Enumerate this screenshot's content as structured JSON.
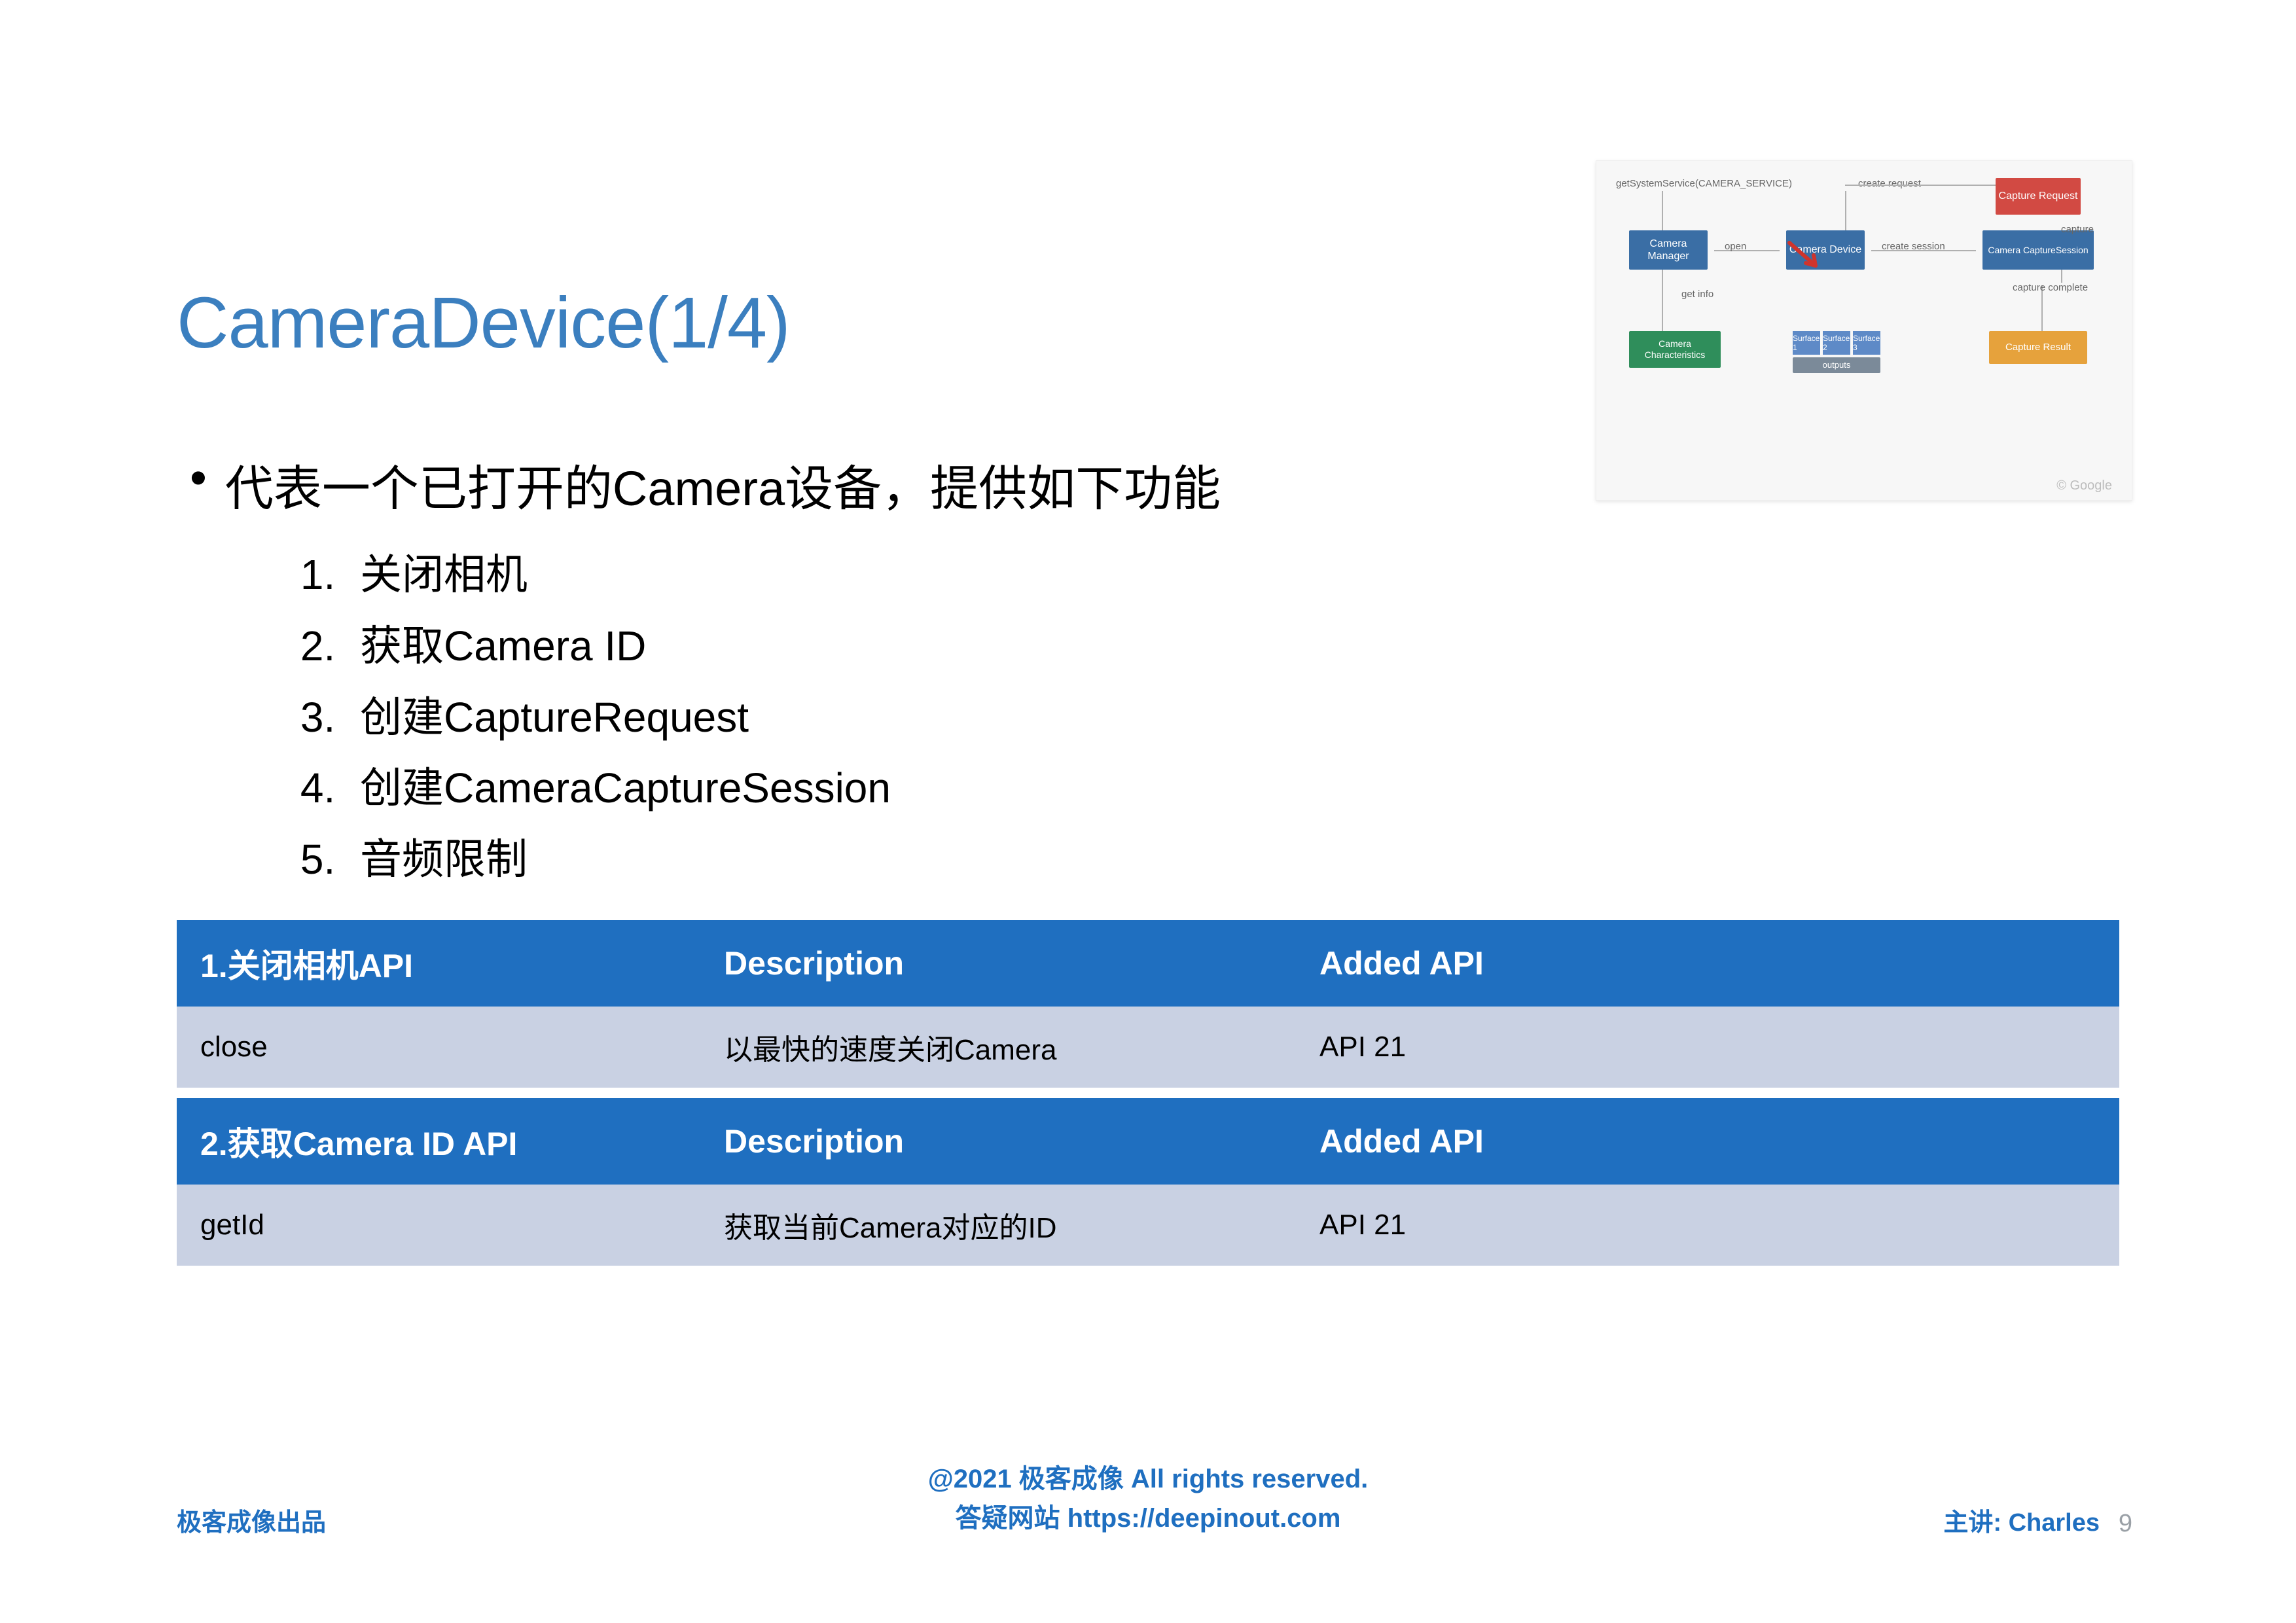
{
  "title": "CameraDevice(1/4)",
  "bullet_main": "代表一个已打开的Camera设备，提供如下功能",
  "ol_items": [
    "关闭相机",
    "获取Camera ID",
    "创建CaptureRequest",
    "创建CameraCaptureSession",
    "音频限制"
  ],
  "table1": {
    "h1": "1.关闭相机API",
    "h2": "Description",
    "h3": "Added API",
    "r1c1": "close",
    "r1c2": "以最快的速度关闭Camera",
    "r1c3": "API 21"
  },
  "table2": {
    "h1": "2.获取Camera ID API",
    "h2": "Description",
    "h3": "Added API",
    "r1c1": "getId",
    "r1c2": "获取当前Camera对应的ID",
    "r1c3": "API 21"
  },
  "footer": {
    "left": "极客成像出品",
    "center1": "@2021 极客成像 All rights reserved.",
    "center2": "答疑网站 https://deepinout.com",
    "right": "主讲: Charles",
    "page": "9"
  },
  "diagram": {
    "api_call": "getSystemService(CAMERA_SERVICE)",
    "create_request": "create request",
    "create_session": "create session",
    "open": "open",
    "get_info": "get info",
    "camera_manager": "Camera\nManager",
    "camera_device": "Camera\nDevice",
    "camera_characteristics": "Camera\nCharacteristics",
    "camera_capsession": "Camera\nCaptureSession",
    "capture_request": "Capture\nRequest",
    "capture_result": "Capture Result",
    "capture": "capture",
    "capture_complete": "capture\ncomplete",
    "outputs": "outputs",
    "surface1": "Surface\n1",
    "surface2": "Surface\n2",
    "surface3": "Surface\n3",
    "credit": "© Google"
  }
}
